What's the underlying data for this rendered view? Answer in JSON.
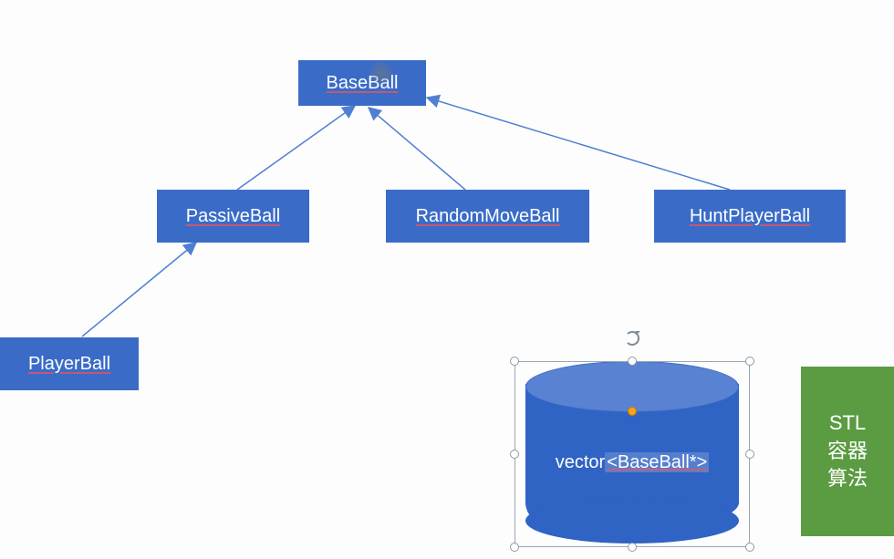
{
  "nodes": {
    "base": "BaseBall",
    "passive": "PassiveBall",
    "random": "RandomMoveBall",
    "hunt": "HuntPlayerBall",
    "player": "PlayerBall"
  },
  "cylinder": {
    "prefix": "vector",
    "tpl": "<BaseBall*>"
  },
  "stl": {
    "line1": "STL",
    "line2": "容器",
    "line3": "算法"
  },
  "colors": {
    "box": "#3a6cc7",
    "stl": "#5b9b42",
    "arrow": "#4f7fd2"
  }
}
